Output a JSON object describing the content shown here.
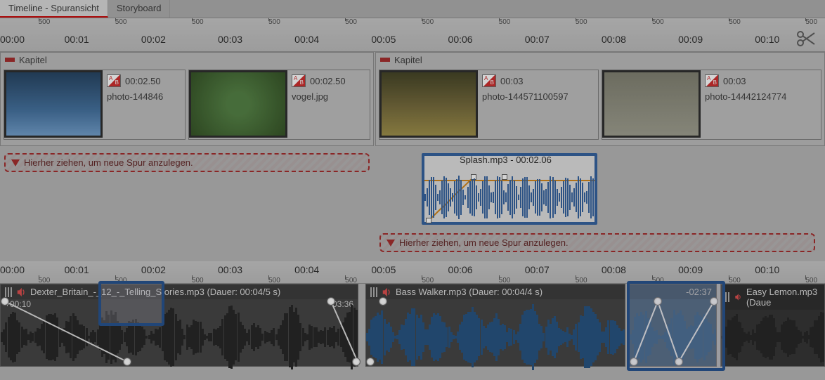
{
  "tabs": {
    "timeline": "Timeline - Spuransicht",
    "storyboard": "Storyboard"
  },
  "ruler": {
    "major": [
      "00:00",
      "00:01",
      "00:02",
      "00:03",
      "00:04",
      "00:05",
      "00:06",
      "00:07",
      "00:08",
      "00:09",
      "00:10"
    ],
    "minor": "500"
  },
  "chapters": {
    "label": "Kapitel",
    "left": {
      "clips": [
        {
          "duration": "00:02.50",
          "name": "photo-144846"
        },
        {
          "duration": "00:02.50",
          "name": "vogel.jpg"
        }
      ]
    },
    "right": {
      "clips": [
        {
          "duration": "00:03",
          "name": "photo-144571100597"
        },
        {
          "duration": "00:03",
          "name": "photo-14442124774"
        }
      ]
    }
  },
  "dropHint": "Hierher ziehen, um neue Spur anzulegen.",
  "splashClip": {
    "label": "Splash.mp3 - 00:02.06"
  },
  "audio": {
    "t1": {
      "title": "Dexter_Britain_-_12_-_Telling_Stories.mp3 (Dauer: 00:04/5 s)",
      "left": "+00:10",
      "right": "-03:36"
    },
    "t2": {
      "title": "Bass Walker.mp3 (Dauer: 00:04/4 s)"
    },
    "t3": {
      "title": "",
      "time": "-02:37"
    },
    "t4": {
      "title": "Easy Lemon.mp3 (Daue"
    }
  }
}
